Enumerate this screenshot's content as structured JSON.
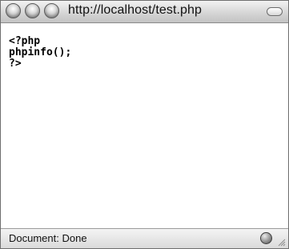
{
  "window": {
    "url": "http://localhost/test.php"
  },
  "page": {
    "code_lines": [
      "<?php",
      "phpinfo();",
      "?>"
    ]
  },
  "statusbar": {
    "text": "Document: Done"
  },
  "icons": {
    "close": "close-window-button",
    "minimize": "minimize-window-button",
    "zoom": "zoom-window-button",
    "toolbar_toggle": "toolbar-toggle-button",
    "status": "globe-icon",
    "resize": "resize-grip-icon"
  }
}
